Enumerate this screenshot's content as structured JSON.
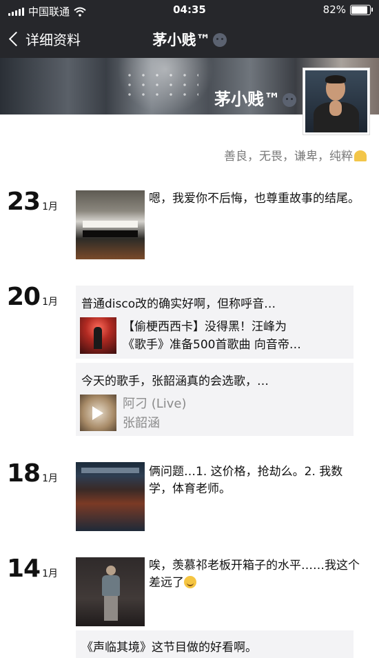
{
  "status_bar": {
    "carrier": "中国联通",
    "time": "04:35",
    "battery": "82%",
    "battery_level": 0.82
  },
  "nav": {
    "back_label": "详细资料",
    "title": "茅小贱™"
  },
  "profile": {
    "cover_name": "茅小贱™",
    "signature": "善良，无畏，谦卑，纯粹"
  },
  "timeline": [
    {
      "day": "23",
      "month": "1月",
      "text": "嗯，我爱你不后悔，也尊重故事的结尾。"
    },
    {
      "day": "20",
      "month": "1月",
      "posts": [
        {
          "text": "普通disco改的确实好啊，但称呼音…",
          "share_line1": "【偷梗西西卡】没得黑！汪峰为",
          "share_line2": "《歌手》准备500首歌曲 向音帝…"
        },
        {
          "text": "今天的歌手，张韶涵真的会选歌，…",
          "share_line1": "阿刁 (Live)",
          "share_line2": "张韶涵"
        }
      ]
    },
    {
      "day": "18",
      "month": "1月",
      "text": "俩问题…1. 这价格，抢劫么。2. 我数学，体育老师。"
    },
    {
      "day": "14",
      "month": "1月",
      "text": "唉，羡慕祁老板开箱子的水平……我这个差远了",
      "post2_text": "《声临其境》这节目做的好看啊。"
    }
  ],
  "icons": {
    "back": "chevron-left-icon",
    "wifi": "wifi-icon",
    "signal": "signal-icon",
    "battery": "battery-icon",
    "play": "play-icon"
  }
}
